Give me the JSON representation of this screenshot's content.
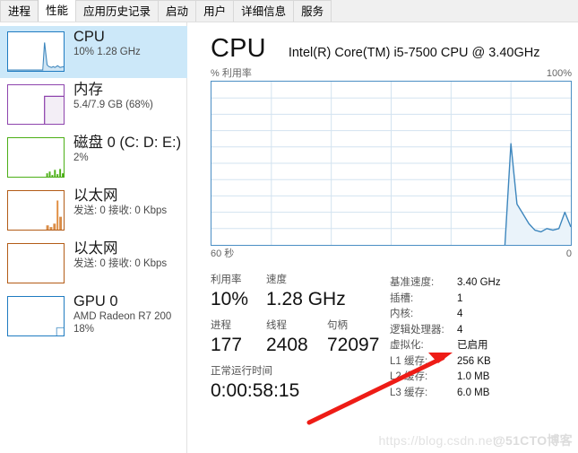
{
  "tabs": [
    {
      "label": "进程",
      "selected": false
    },
    {
      "label": "性能",
      "selected": true
    },
    {
      "label": "应用历史记录",
      "selected": false
    },
    {
      "label": "启动",
      "selected": false
    },
    {
      "label": "用户",
      "selected": false
    },
    {
      "label": "详细信息",
      "selected": false
    },
    {
      "label": "服务",
      "selected": false
    }
  ],
  "sidebar": {
    "items": [
      {
        "title": "CPU",
        "sub": "10% 1.28 GHz",
        "sub2": "",
        "color": "#1f7bc1",
        "active": true
      },
      {
        "title": "内存",
        "sub": "5.4/7.9 GB (68%)",
        "sub2": "",
        "color": "#8e44ad",
        "active": false
      },
      {
        "title": "磁盘 0 (C: D: E:)",
        "sub": "2%",
        "sub2": "",
        "color": "#4caf16",
        "active": false
      },
      {
        "title": "以太网",
        "sub": "发送: 0 接收: 0 Kbps",
        "sub2": "",
        "color": "#b35c17",
        "active": false
      },
      {
        "title": "以太网",
        "sub": "发送: 0 接收: 0 Kbps",
        "sub2": "",
        "color": "#b35c17",
        "active": false
      },
      {
        "title": "GPU 0",
        "sub": "AMD Radeon R7 200",
        "sub2": "18%",
        "color": "#1f7bc1",
        "active": false
      }
    ]
  },
  "header": {
    "title": "CPU",
    "model": "Intel(R) Core(TM) i5-7500 CPU @ 3.40GHz"
  },
  "chart_axis": {
    "y_label": "% 利用率",
    "y_max": "100%",
    "x_left": "60 秒",
    "x_right": "0"
  },
  "stats": {
    "utilization_label": "利用率",
    "utilization_value": "10%",
    "speed_label": "速度",
    "speed_value": "1.28 GHz",
    "processes_label": "进程",
    "processes_value": "177",
    "threads_label": "线程",
    "threads_value": "2408",
    "handles_label": "句柄",
    "handles_value": "72097",
    "uptime_label": "正常运行时间",
    "uptime_value": "0:00:58:15"
  },
  "specs": [
    {
      "key": "基准速度:",
      "value": "3.40 GHz"
    },
    {
      "key": "插槽:",
      "value": "1"
    },
    {
      "key": "内核:",
      "value": "4"
    },
    {
      "key": "逻辑处理器:",
      "value": "4"
    },
    {
      "key": "虚拟化:",
      "value": "已启用"
    },
    {
      "key": "L1 缓存:",
      "value": "256 KB"
    },
    {
      "key": "L2 缓存:",
      "value": "1.0 MB"
    },
    {
      "key": "L3 缓存:",
      "value": "6.0 MB"
    }
  ],
  "annotation": {
    "arrow_color": "#ee1c16",
    "points_to": "已启用"
  },
  "watermark": {
    "url": "https://blog.csdn.net",
    "site": "@51CTO博客"
  },
  "chart_data": {
    "type": "area",
    "title": "CPU 利用率",
    "xlabel": "60 秒",
    "ylabel": "% 利用率",
    "ylim": [
      0,
      100
    ],
    "xlim": [
      60,
      0
    ],
    "grid": true,
    "x": [
      60,
      58,
      56,
      54,
      52,
      50,
      48,
      46,
      44,
      42,
      40,
      38,
      36,
      34,
      32,
      30,
      28,
      26,
      24,
      22,
      20,
      18,
      16,
      14,
      12,
      11,
      10,
      9,
      8,
      7,
      6,
      5,
      4,
      3,
      2,
      1,
      0
    ],
    "values": [
      0,
      0,
      0,
      0,
      0,
      0,
      0,
      0,
      0,
      0,
      0,
      0,
      0,
      0,
      0,
      0,
      0,
      0,
      0,
      0,
      0,
      0,
      0,
      0,
      0,
      0,
      62,
      25,
      19,
      13,
      9,
      8,
      10,
      9,
      10,
      20,
      11
    ],
    "series": [
      {
        "name": "% 利用率",
        "color": "#3d86bd"
      }
    ]
  }
}
